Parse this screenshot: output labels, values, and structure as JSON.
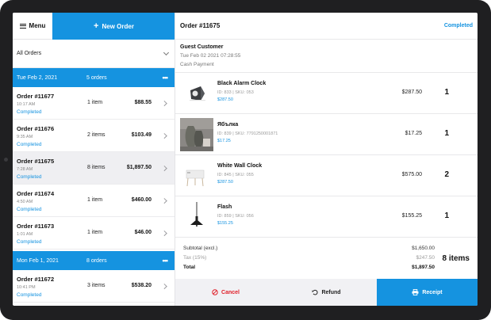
{
  "header": {
    "menu_label": "Menu",
    "new_order_label": "New Order"
  },
  "filter": {
    "label": "All Orders"
  },
  "groups": [
    {
      "date": "Tue Feb 2, 2021",
      "count": "5 orders",
      "more": "•••"
    },
    {
      "date": "Mon Feb 1, 2021",
      "count": "8 orders",
      "more": "•••"
    }
  ],
  "orders": [
    {
      "number": "Order #11677",
      "time": "10:17 AM",
      "status": "Completed",
      "items": "1 item",
      "amount": "$88.55"
    },
    {
      "number": "Order #11676",
      "time": "9:35 AM",
      "status": "Completed",
      "items": "2 items",
      "amount": "$103.49"
    },
    {
      "number": "Order #11675",
      "time": "7:28 AM",
      "status": "Completed",
      "items": "8 items",
      "amount": "$1,897.50"
    },
    {
      "number": "Order #11674",
      "time": "4:50 AM",
      "status": "Completed",
      "items": "1 item",
      "amount": "$460.00"
    },
    {
      "number": "Order #11673",
      "time": "1:01 AM",
      "status": "Completed",
      "items": "1 item",
      "amount": "$46.00"
    },
    {
      "number": "Order #11672",
      "time": "10:41 PM",
      "status": "Completed",
      "items": "3 items",
      "amount": "$538.20"
    }
  ],
  "detail": {
    "title": "Order #11675",
    "status": "Completed",
    "customer": "Guest Customer",
    "datetime": "Tue Feb 02 2021 07:28:55",
    "payment": "Cash Payment",
    "products": [
      {
        "name": "Black Alarm Clock",
        "meta": "ID: 833 | SKU: 053",
        "price": "$287.50",
        "total": "$287.50",
        "qty": "1"
      },
      {
        "name": "Ябълка",
        "meta": "ID: 839 | SKU: 7791250001871",
        "price": "$17.25",
        "total": "$17.25",
        "qty": "1"
      },
      {
        "name": "White Wall Clock",
        "meta": "ID: 845 | SKU: 055",
        "price": "$287.50",
        "total": "$575.00",
        "qty": "2"
      },
      {
        "name": "Flash",
        "meta": "ID: 859 | SKU: 056",
        "price": "$155.25",
        "total": "$155.25",
        "qty": "1"
      }
    ],
    "summary": {
      "subtotal_label": "Subtotal (excl.)",
      "subtotal": "$1,650.00",
      "tax_label": "Tax (15%)",
      "tax": "$247.50",
      "total_label": "Total",
      "total": "$1,897.50",
      "items_count": "8 items"
    },
    "actions": {
      "cancel": "Cancel",
      "refund": "Refund",
      "receipt": "Receipt"
    }
  },
  "colors": {
    "accent": "#1593e0",
    "danger": "#e0202a",
    "frame": "#1f1f21"
  }
}
